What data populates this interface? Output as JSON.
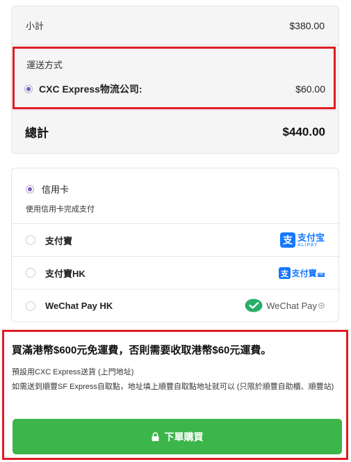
{
  "summary": {
    "subtotal_label": "小計",
    "subtotal_value": "$380.00",
    "shipping_title": "運送方式",
    "shipping_option_name": "CXC Express物流公司:",
    "shipping_option_price": "$60.00",
    "total_label": "總計",
    "total_value": "$440.00"
  },
  "payment": {
    "credit_label": "信用卡",
    "credit_desc": "使用信用卡完成支付",
    "options": [
      {
        "label": "支付寶",
        "logo_text": "支付宝",
        "logo_sub": "ALIPAY"
      },
      {
        "label": "支付寶HK",
        "logo_text": "支付寶",
        "logo_sub": "HK"
      },
      {
        "label": "WeChat Pay HK",
        "logo_text": "WeChat Pay"
      }
    ]
  },
  "notice": {
    "title": "買滿港幣$600元免運費，否則需要收取港幣$60元運費。",
    "line1": "預設用CXC Express送貨 (上門地址)",
    "line2": "如需送到順豐SF Express自取點，地址填上順豐自取點地址就可以 (只限於順豐自助櫃、順豐站)"
  },
  "order_button_label": "下單購買",
  "colors": {
    "highlight_border": "#e01b24",
    "button_green": "#3cb54a",
    "radio_purple": "#7b5cc7",
    "alipay_blue": "#1677ff",
    "wechat_green": "#2aae67"
  }
}
